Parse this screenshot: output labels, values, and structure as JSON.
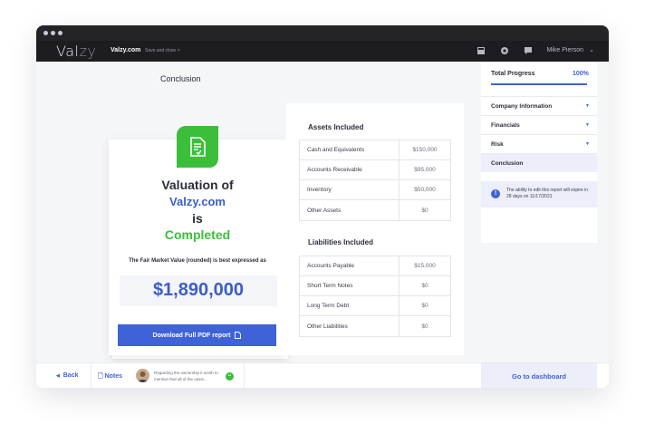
{
  "header": {
    "logo_main": "Val",
    "logo_accent": "zy",
    "site": "Valzy.com",
    "save_close": "Save and close  ×",
    "user_name": "Mike Pierson",
    "icons": [
      "calculator-icon",
      "support-icon",
      "chat-icon",
      "chevron-down-icon"
    ]
  },
  "conclusion": {
    "label": "Conclusion",
    "title_line1": "Valuation of",
    "title_line2": "Valzy.com",
    "title_line3": "is",
    "title_line4": "Completed",
    "fmv_text": "The Fair Market Value (rounded) is best expressed as",
    "amount": "$1,890,000",
    "download_label": "Download Full PDF report"
  },
  "assets": {
    "title": "Assets Included",
    "rows": [
      {
        "name": "Cash and Equivalents",
        "value": "$150,000"
      },
      {
        "name": "Accounts Receivable",
        "value": "$95,000"
      },
      {
        "name": "Inventory",
        "value": "$50,000"
      },
      {
        "name": "Other Assets",
        "value": "$0"
      }
    ]
  },
  "liabilities": {
    "title": "Liabilities Included",
    "rows": [
      {
        "name": "Accounts Payable",
        "value": "$15,000"
      },
      {
        "name": "Short Term Notes",
        "value": "$0"
      },
      {
        "name": "Long Term Debt",
        "value": "$0"
      },
      {
        "name": "Other Liabilities",
        "value": "$0"
      }
    ]
  },
  "sidebar": {
    "progress_label": "Total Progress",
    "progress_value": "100%",
    "progress_fraction": 1.0,
    "items": [
      {
        "label": "Company Information"
      },
      {
        "label": "Financials"
      },
      {
        "label": "Risk"
      },
      {
        "label": "Conclusion"
      }
    ],
    "notice": "The ability to edit this report will expire in 28 days on 11/17/2021"
  },
  "footer": {
    "back_label": "Back",
    "notes_label": "Notes",
    "note_preview": "Regarding the ownership it worth to mention that all of the owne...",
    "dashboard_label": "Go to dashboard"
  },
  "colors": {
    "accent": "#3f62d8",
    "success": "#3bbf3b",
    "topbar": "#1c1c21"
  }
}
